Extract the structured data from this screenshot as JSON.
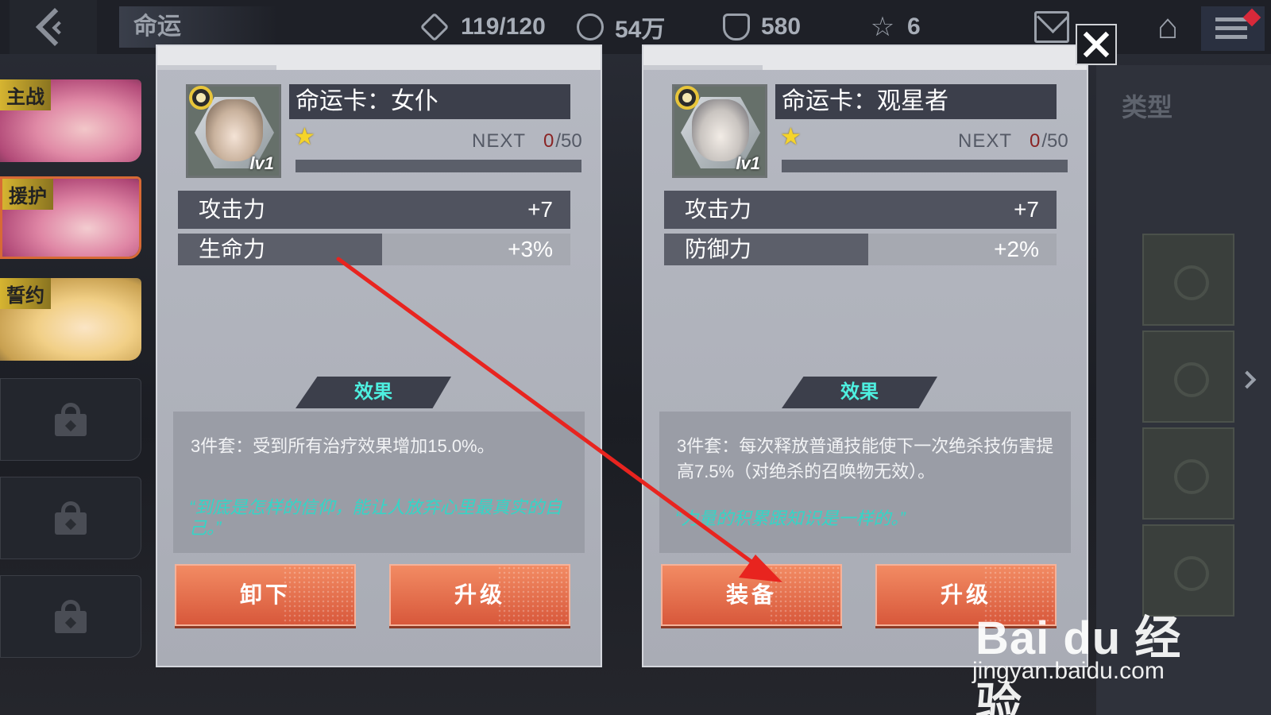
{
  "header": {
    "title": "命运",
    "resources": [
      {
        "icon": "stamina-icon",
        "value": "119/120"
      },
      {
        "icon": "coin-icon",
        "value": "54万"
      },
      {
        "icon": "crystal-icon",
        "value": "580"
      },
      {
        "icon": "star-icon",
        "value": "6"
      }
    ]
  },
  "sidebar": {
    "slots": [
      {
        "tag": "主战",
        "state": "normal"
      },
      {
        "tag": "援护",
        "state": "active"
      },
      {
        "tag": "誓约",
        "state": "normal"
      },
      {
        "tag": "",
        "state": "locked"
      },
      {
        "tag": "",
        "state": "locked"
      },
      {
        "tag": "",
        "state": "locked"
      }
    ]
  },
  "background": {
    "type_label": "类型"
  },
  "cards": [
    {
      "name": "命运卡：女仆",
      "level": "lv1",
      "next_label": "NEXT",
      "next_current": "0",
      "next_total": "/50",
      "exp_fraction": 0,
      "stats": [
        {
          "name": "攻击力",
          "value": "+7"
        },
        {
          "name": "生命力",
          "value": "+3%"
        }
      ],
      "effect_title": "效果",
      "effect_desc": "3件套：受到所有治疗效果增加15.0%。",
      "quote": "“到底是怎样的信仰，能让人放弃心里最真实的自己。”",
      "buttons": [
        "卸下",
        "升级"
      ]
    },
    {
      "name": "命运卡：观星者",
      "level": "lv1",
      "next_label": "NEXT",
      "next_current": "0",
      "next_total": "/50",
      "exp_fraction": 0,
      "stats": [
        {
          "name": "攻击力",
          "value": "+7"
        },
        {
          "name": "防御力",
          "value": "+2%"
        }
      ],
      "effect_title": "效果",
      "effect_desc": "3件套：每次释放普通技能使下一次绝杀技伤害提高7.5%（对绝杀的召唤物无效）。",
      "quote": "“力量的积累跟知识是一样的。”",
      "buttons": [
        "装备",
        "升级"
      ]
    }
  ],
  "colors": {
    "accent_button": "#e26a47",
    "quote_text": "#33d6c7",
    "star": "#f5d42a",
    "annotation_arrow": "#e8241f"
  },
  "watermark": {
    "brand": "Bai du 经验",
    "url": "jingyan.baidu.com"
  }
}
